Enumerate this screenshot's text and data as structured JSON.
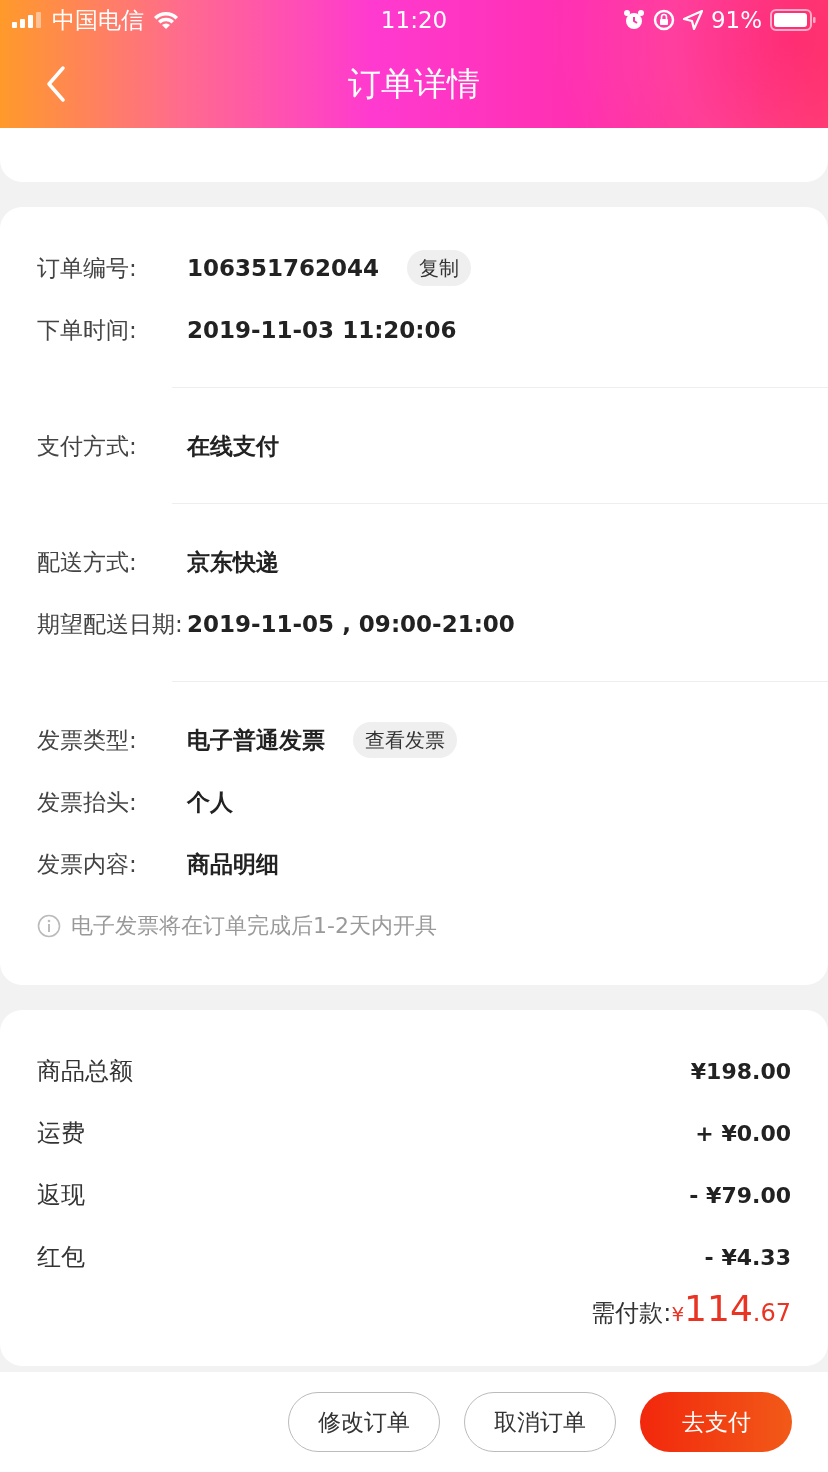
{
  "status_bar": {
    "carrier": "中国电信",
    "time": "11:20",
    "battery": "91%"
  },
  "header": {
    "title": "订单详情"
  },
  "order_info": {
    "groups": [
      {
        "rows": [
          {
            "label": "订单编号:",
            "value": "106351762044",
            "action": "复制"
          },
          {
            "label": "下单时间:",
            "value": "2019-11-03 11:20:06"
          }
        ]
      },
      {
        "rows": [
          {
            "label": "支付方式:",
            "value": "在线支付"
          }
        ]
      },
      {
        "rows": [
          {
            "label": "配送方式:",
            "value": "京东快递"
          },
          {
            "label": "期望配送日期:",
            "value": "2019-11-05 , 09:00-21:00"
          }
        ]
      },
      {
        "rows": [
          {
            "label": "发票类型:",
            "value": "电子普通发票",
            "action": "查看发票"
          },
          {
            "label": "发票抬头:",
            "value": "个人"
          },
          {
            "label": "发票内容:",
            "value": "商品明细"
          }
        ]
      }
    ],
    "note": "电子发票将在订单完成后1-2天内开具"
  },
  "summary": {
    "rows": [
      {
        "label": "商品总额",
        "amount": "¥198.00"
      },
      {
        "label": "运费",
        "amount": "+ ¥0.00"
      },
      {
        "label": "返现",
        "amount": "- ¥79.00"
      },
      {
        "label": "红包",
        "amount": "- ¥4.33"
      }
    ],
    "total": {
      "label": "需付款:",
      "currency": "¥",
      "integer": "114",
      "decimal": ".67"
    }
  },
  "buttons": [
    {
      "label": "修改订单",
      "kind": "outline"
    },
    {
      "label": "取消订单",
      "kind": "outline"
    },
    {
      "label": "去支付",
      "kind": "primary"
    }
  ]
}
